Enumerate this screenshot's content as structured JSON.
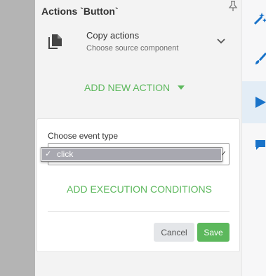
{
  "panel": {
    "title": "Actions `Button`"
  },
  "copy_actions": {
    "title": "Copy actions",
    "subtitle": "Choose source component"
  },
  "add_new_action_label": "ADD NEW ACTION",
  "event_form": {
    "label": "Choose event type",
    "selected_option": "click",
    "add_conditions_label": "ADD EXECUTION CONDITIONS",
    "cancel_label": "Cancel",
    "save_label": "Save"
  },
  "colors": {
    "accent_green": "#5cb85c",
    "rail_blue": "#1a73c9"
  },
  "icons": {
    "pin": "pin-icon",
    "copy": "copy-document-icon",
    "chevron": "chevron-down-icon",
    "rail": [
      "magic-wand-icon",
      "paintbrush-icon",
      "play-icon",
      "comment-icon"
    ]
  }
}
